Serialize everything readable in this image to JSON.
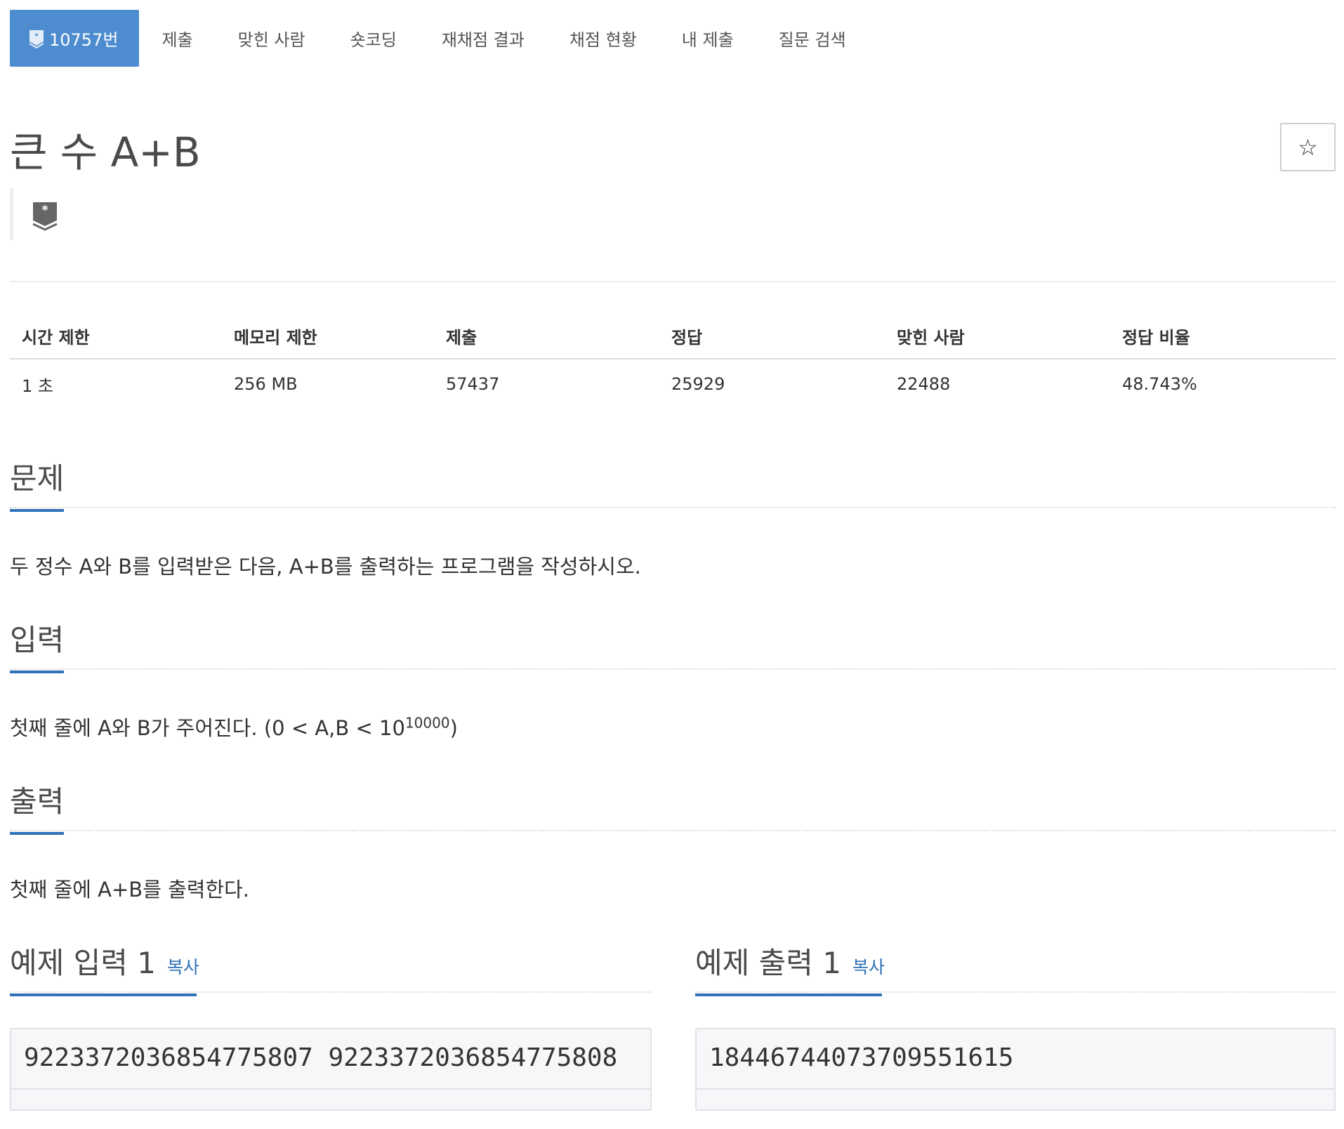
{
  "nav": {
    "active": "10757번",
    "items": [
      "제출",
      "맞힌 사람",
      "숏코딩",
      "재채점 결과",
      "채점 현황",
      "내 제출",
      "질문 검색"
    ]
  },
  "problem": {
    "title": "큰 수 A+B",
    "star": "☆"
  },
  "info": {
    "headers": [
      "시간 제한",
      "메모리 제한",
      "제출",
      "정답",
      "맞힌 사람",
      "정답 비율"
    ],
    "values": [
      "1 초",
      "256 MB",
      "57437",
      "25929",
      "22488",
      "48.743%"
    ]
  },
  "sections": {
    "problem_heading": "문제",
    "problem_text": "두 정수 A와 B를 입력받은 다음, A+B를 출력하는 프로그램을 작성하시오.",
    "input_heading": "입력",
    "input_text_main": "첫째 줄에 A와 B가 주어진다. (0 < A,B < 10",
    "input_text_sup": "10000",
    "input_text_end": ")",
    "output_heading": "출력",
    "output_text": "첫째 줄에 A+B를 출력한다."
  },
  "samples": {
    "input_heading": "예제 입력 1",
    "output_heading": "예제 출력 1",
    "copy_label": "복사",
    "input_value": "9223372036854775807 9223372036854775808",
    "output_value": "18446744073709551615"
  },
  "colors": {
    "accent": "#4d8ccf",
    "underline": "#2f72b8"
  }
}
